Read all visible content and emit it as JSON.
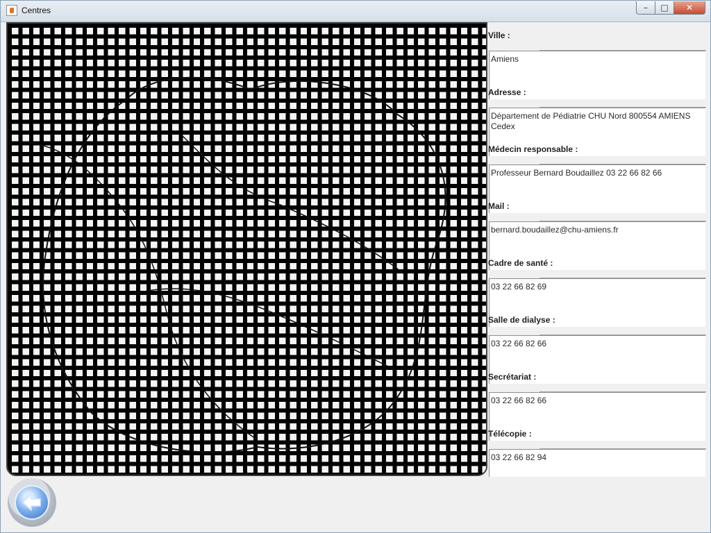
{
  "window": {
    "title": "Centres",
    "icon": "java-icon"
  },
  "map": {
    "icon": "map-grid"
  },
  "details": {
    "fields": [
      {
        "label": "Ville :",
        "value": "Amiens"
      },
      {
        "label": "Adresse :",
        "value": "Département de Pédiatrie CHU Nord 800554 AMIENS Cedex"
      },
      {
        "label": "Médecin responsable :",
        "value": "Professeur Bernard Boudaillez 03 22 66 82 66"
      },
      {
        "label": "Mail :",
        "value": "bernard.boudaillez@chu-amiens.fr"
      },
      {
        "label": "Cadre de santé :",
        "value": "03 22 66 82 69"
      },
      {
        "label": "Salle de dialyse :",
        "value": "03 22 66 82 66"
      },
      {
        "label": "Secrétariat :",
        "value": "03 22 66 82 66"
      },
      {
        "label": "Télécopie :",
        "value": "03 22 66 82 94"
      }
    ]
  },
  "navigation": {
    "back_icon": "back-arrow-icon"
  },
  "colors": {
    "window_bg": "#f0f0f0",
    "close_button": "#c74b30",
    "back_button": "#2d66c2"
  }
}
